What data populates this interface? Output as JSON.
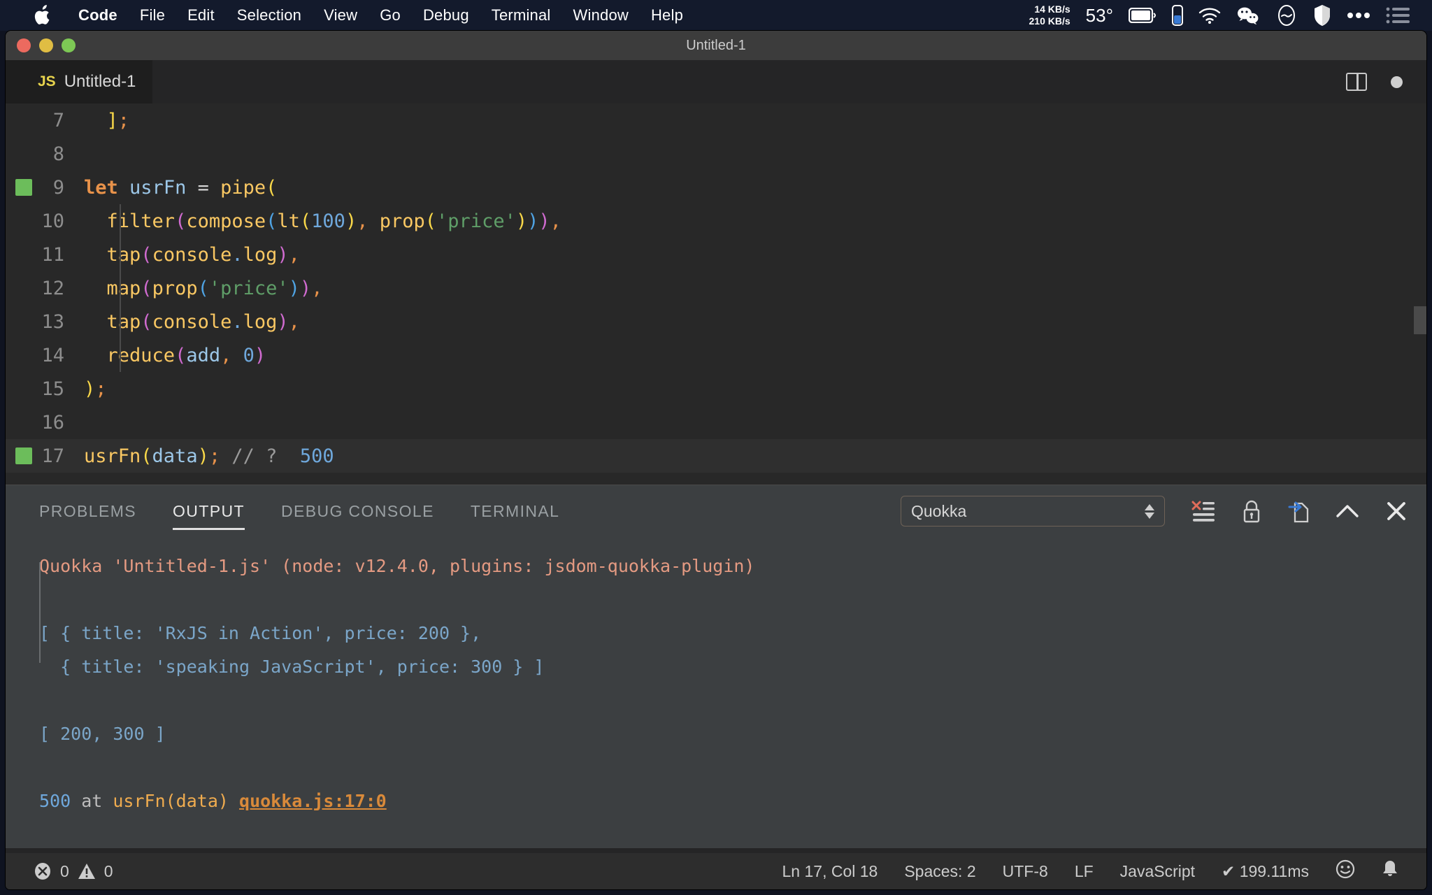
{
  "menubar": {
    "apple_icon": "apple-logo",
    "items": [
      {
        "label": "Code",
        "bold": true
      },
      {
        "label": "File",
        "bold": false
      },
      {
        "label": "Edit",
        "bold": false
      },
      {
        "label": "Selection",
        "bold": false
      },
      {
        "label": "View",
        "bold": false
      },
      {
        "label": "Go",
        "bold": false
      },
      {
        "label": "Debug",
        "bold": false
      },
      {
        "label": "Terminal",
        "bold": false
      },
      {
        "label": "Window",
        "bold": false
      },
      {
        "label": "Help",
        "bold": false
      }
    ],
    "net_up": "14 KB/s",
    "net_down": "210 KB/s",
    "temperature": "53°",
    "status_icons": [
      "battery-icon",
      "battery-level-icon",
      "wifi-icon",
      "wechat-icon",
      "do-not-disturb-icon",
      "shield-icon",
      "ellipsis-icon",
      "list-icon"
    ]
  },
  "window": {
    "title": "Untitled-1",
    "traffic_lights": [
      "close-button",
      "minimize-button",
      "maximize-button"
    ]
  },
  "tabbar": {
    "tab": {
      "badge": "JS",
      "label": "Untitled-1"
    },
    "actions": [
      "split-editor-icon",
      "more-actions-icon"
    ]
  },
  "editor": {
    "lines": [
      {
        "num": "7",
        "marked": false,
        "current": false,
        "indent": false,
        "tokens": [
          {
            "t": "  ",
            "c": "t-plain"
          },
          {
            "t": "]",
            "c": "b1"
          },
          {
            "t": ";",
            "c": "b-orange"
          }
        ]
      },
      {
        "num": "8",
        "marked": false,
        "current": false,
        "indent": false,
        "tokens": []
      },
      {
        "num": "9",
        "marked": true,
        "current": false,
        "indent": false,
        "tokens": [
          {
            "t": "let",
            "c": "t-kw"
          },
          {
            "t": " ",
            "c": "t-plain"
          },
          {
            "t": "usrFn",
            "c": "t-var"
          },
          {
            "t": " ",
            "c": "t-plain"
          },
          {
            "t": "=",
            "c": "t-op"
          },
          {
            "t": " ",
            "c": "t-plain"
          },
          {
            "t": "pipe",
            "c": "t-fn"
          },
          {
            "t": "(",
            "c": "b1"
          }
        ]
      },
      {
        "num": "10",
        "marked": false,
        "current": false,
        "indent": true,
        "tokens": [
          {
            "t": "  ",
            "c": "t-plain"
          },
          {
            "t": "filter",
            "c": "t-fn"
          },
          {
            "t": "(",
            "c": "b2"
          },
          {
            "t": "compose",
            "c": "t-fn"
          },
          {
            "t": "(",
            "c": "b3"
          },
          {
            "t": "lt",
            "c": "t-fn"
          },
          {
            "t": "(",
            "c": "b1"
          },
          {
            "t": "100",
            "c": "t-num"
          },
          {
            "t": ")",
            "c": "b1"
          },
          {
            "t": ",",
            "c": "b-orange"
          },
          {
            "t": " ",
            "c": "t-plain"
          },
          {
            "t": "prop",
            "c": "t-fn"
          },
          {
            "t": "(",
            "c": "b1"
          },
          {
            "t": "'price'",
            "c": "t-str"
          },
          {
            "t": ")",
            "c": "b1"
          },
          {
            "t": ")",
            "c": "b3"
          },
          {
            "t": ")",
            "c": "b2"
          },
          {
            "t": ",",
            "c": "b-orange"
          }
        ]
      },
      {
        "num": "11",
        "marked": false,
        "current": false,
        "indent": true,
        "tokens": [
          {
            "t": "  ",
            "c": "t-plain"
          },
          {
            "t": "tap",
            "c": "t-fn"
          },
          {
            "t": "(",
            "c": "b2"
          },
          {
            "t": "console",
            "c": "t-fn"
          },
          {
            "t": ".",
            "c": "t-num"
          },
          {
            "t": "log",
            "c": "t-fn"
          },
          {
            "t": ")",
            "c": "b2"
          },
          {
            "t": ",",
            "c": "b-orange"
          }
        ]
      },
      {
        "num": "12",
        "marked": false,
        "current": false,
        "indent": true,
        "tokens": [
          {
            "t": "  ",
            "c": "t-plain"
          },
          {
            "t": "map",
            "c": "t-fn"
          },
          {
            "t": "(",
            "c": "b2"
          },
          {
            "t": "prop",
            "c": "t-fn"
          },
          {
            "t": "(",
            "c": "b3"
          },
          {
            "t": "'price'",
            "c": "t-str"
          },
          {
            "t": ")",
            "c": "b3"
          },
          {
            "t": ")",
            "c": "b2"
          },
          {
            "t": ",",
            "c": "b-orange"
          }
        ]
      },
      {
        "num": "13",
        "marked": false,
        "current": false,
        "indent": true,
        "tokens": [
          {
            "t": "  ",
            "c": "t-plain"
          },
          {
            "t": "tap",
            "c": "t-fn"
          },
          {
            "t": "(",
            "c": "b2"
          },
          {
            "t": "console",
            "c": "t-fn"
          },
          {
            "t": ".",
            "c": "t-num"
          },
          {
            "t": "log",
            "c": "t-fn"
          },
          {
            "t": ")",
            "c": "b2"
          },
          {
            "t": ",",
            "c": "b-orange"
          }
        ]
      },
      {
        "num": "14",
        "marked": false,
        "current": false,
        "indent": true,
        "tokens": [
          {
            "t": "  ",
            "c": "t-plain"
          },
          {
            "t": "reduce",
            "c": "t-fn"
          },
          {
            "t": "(",
            "c": "b2"
          },
          {
            "t": "add",
            "c": "t-var"
          },
          {
            "t": ",",
            "c": "b-orange"
          },
          {
            "t": " ",
            "c": "t-plain"
          },
          {
            "t": "0",
            "c": "t-num"
          },
          {
            "t": ")",
            "c": "b2"
          }
        ]
      },
      {
        "num": "15",
        "marked": false,
        "current": false,
        "indent": false,
        "tokens": [
          {
            "t": ")",
            "c": "b1"
          },
          {
            "t": ";",
            "c": "b-orange"
          }
        ]
      },
      {
        "num": "16",
        "marked": false,
        "current": false,
        "indent": false,
        "tokens": []
      },
      {
        "num": "17",
        "marked": true,
        "current": true,
        "indent": false,
        "tokens": [
          {
            "t": "usrFn",
            "c": "t-fn"
          },
          {
            "t": "(",
            "c": "b1"
          },
          {
            "t": "data",
            "c": "t-var"
          },
          {
            "t": ")",
            "c": "b1"
          },
          {
            "t": ";",
            "c": "b-orange"
          },
          {
            "t": " ",
            "c": "t-plain"
          },
          {
            "t": "// ?",
            "c": "t-comment"
          },
          {
            "t": "  ",
            "c": "t-plain"
          },
          {
            "t": "500",
            "c": "t-num"
          }
        ]
      }
    ]
  },
  "panel": {
    "tabs": [
      {
        "label": "PROBLEMS",
        "active": false
      },
      {
        "label": "OUTPUT",
        "active": true
      },
      {
        "label": "DEBUG CONSOLE",
        "active": false
      },
      {
        "label": "TERMINAL",
        "active": false
      }
    ],
    "channel_selected": "Quokka",
    "channel_options": [
      "Quokka"
    ],
    "actions": [
      "clear-output-icon",
      "lock-scrolling-icon",
      "open-in-editor-icon",
      "maximize-panel-icon",
      "close-panel-icon"
    ],
    "output_lines": [
      {
        "segments": [
          {
            "t": "Quokka 'Untitled-1.js' (node: v12.4.0, plugins: jsdom-quokka-plugin)",
            "c": "o-head"
          }
        ]
      },
      {
        "segments": []
      },
      {
        "segments": [
          {
            "t": "[ { title: 'RxJS in Action', price: 200 },",
            "c": "o-blue"
          }
        ]
      },
      {
        "segments": [
          {
            "t": "  { title: 'speaking JavaScript', price: 300 } ]",
            "c": "o-blue"
          }
        ]
      },
      {
        "segments": []
      },
      {
        "segments": [
          {
            "t": "[ 200, 300 ]",
            "c": "o-blue"
          }
        ]
      },
      {
        "segments": []
      },
      {
        "segments": [
          {
            "t": "500",
            "c": "o-num"
          },
          {
            "t": " at ",
            "c": "o-dim"
          },
          {
            "t": "usrFn(data)",
            "c": "o-fn"
          },
          {
            "t": " ",
            "c": "o-dim"
          },
          {
            "t": "quokka.js:17:0",
            "c": "o-link"
          }
        ]
      }
    ]
  },
  "statusbar": {
    "errors": "0",
    "warnings": "0",
    "cursor": "Ln 17, Col 18",
    "spaces": "Spaces: 2",
    "encoding": "UTF-8",
    "eol": "LF",
    "language": "JavaScript",
    "quokka_status": "✔ 199.11ms",
    "right_icons": [
      "feedback-smiley-icon",
      "notifications-bell-icon"
    ]
  }
}
